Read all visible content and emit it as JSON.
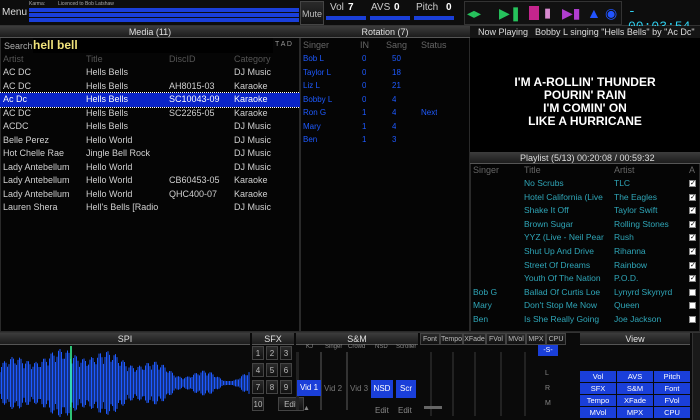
{
  "top": {
    "menu_label": "Menu",
    "karma_label": "Karma:",
    "license_text": "Licenced to Bob Latshaw",
    "mute_label": "Mute",
    "vol_label": "Vol",
    "vol_value": "7",
    "avs_label": "AVS",
    "avs_value": "0",
    "pitch_label": "Pitch",
    "pitch_value": "0",
    "time": "- 00:03:54"
  },
  "media": {
    "header": "Media (11)",
    "search_label": "Search",
    "search_value": "hell bell",
    "tad_label": "T A D",
    "columns": [
      "Artist",
      "Title",
      "DiscID",
      "Category"
    ],
    "rows": [
      [
        "AC DC",
        "Hells Bells",
        "",
        "DJ Music"
      ],
      [
        "AC DC",
        "Hells Bells",
        "AH8015-03",
        "Karaoke"
      ],
      [
        "Ac Dc",
        "Hells Bells",
        "SC10043-09",
        "Karaoke"
      ],
      [
        "AC DC",
        "Hells Bells",
        "SC2265-05",
        "Karaoke"
      ],
      [
        "ACDC",
        "Hells Bells",
        "",
        "DJ Music"
      ],
      [
        "Belle Perez",
        "Hello World",
        "",
        "DJ Music"
      ],
      [
        "Hot Chelle Rae",
        "Jingle Bell Rock",
        "",
        "DJ Music"
      ],
      [
        "Lady Antebellum",
        "Hello World",
        "",
        "DJ Music"
      ],
      [
        "Lady Antebellum",
        "Hello World",
        "CB60453-05",
        "Karaoke"
      ],
      [
        "Lady Antebellum",
        "Hello World",
        "QHC400-07",
        "Karaoke"
      ],
      [
        "Lauren Shera",
        "Hell's Bells [Radio",
        "",
        "DJ Music"
      ]
    ],
    "selected_index": 2
  },
  "rotation": {
    "header": "Rotation (7)",
    "columns": [
      "Singer",
      "IN",
      "Sang",
      "Status"
    ],
    "rows": [
      [
        "Bob L",
        "0",
        "50",
        ""
      ],
      [
        "Taylor L",
        "0",
        "18",
        ""
      ],
      [
        "Liz L",
        "0",
        "21",
        ""
      ],
      [
        "Bobby L",
        "0",
        "4",
        ""
      ],
      [
        "Ron G",
        "1",
        "4",
        "Next"
      ],
      [
        "Mary",
        "1",
        "4",
        ""
      ],
      [
        "Ben",
        "1",
        "3",
        ""
      ]
    ]
  },
  "now_playing": {
    "label": "Now Playing",
    "text": "Bobby L singing \"Hells Bells\" by \"Ac Dc\"",
    "lyrics": [
      "I'M A-ROLLIN' THUNDER",
      "POURIN' RAIN",
      "I'M COMIN' ON",
      "LIKE A HURRICANE"
    ]
  },
  "playlist": {
    "header": "Playlist (5/13)",
    "times": "00:20:08 / 00:59:32",
    "columns": [
      "Singer",
      "Title",
      "Artist",
      "A"
    ],
    "rows": [
      [
        "",
        "No Scrubs",
        "TLC",
        true
      ],
      [
        "",
        "Hotel California (Live",
        "The Eagles",
        true
      ],
      [
        "",
        "Shake It Off",
        "Taylor Swift",
        true
      ],
      [
        "",
        "Brown Sugar",
        "Rolling Stones",
        true
      ],
      [
        "",
        "YYZ (Live - Neil Pear",
        "Rush",
        true
      ],
      [
        "",
        "Shut Up And Drive",
        "Rihanna",
        true
      ],
      [
        "",
        "Street Of Dreams",
        "Rainbow",
        true
      ],
      [
        "",
        "Youth Of The Nation",
        "P.O.D.",
        true
      ],
      [
        "Bob G",
        "Ballad Of Curtis Loe",
        "Lynyrd Skynyrd",
        false
      ],
      [
        "Mary",
        "Don't Stop Me Now",
        "Queen",
        false
      ],
      [
        "Ben",
        "Is She Really Going",
        "Joe Jackson",
        false
      ]
    ]
  },
  "bottom": {
    "spi_label": "SPI",
    "sfx_label": "SFX",
    "sfx_buttons": [
      "1",
      "2",
      "3",
      "4",
      "5",
      "6",
      "7",
      "8",
      "9",
      "10",
      "Edit"
    ],
    "sm_label": "S&M",
    "sm_headers": [
      "KJ",
      "Singer",
      "Crowd",
      "NSD",
      "Scroller"
    ],
    "vid_buttons": [
      "Vid 1",
      "Vid 2",
      "Vid 3"
    ],
    "nsd_label": "NSD",
    "scr_label": "Scr",
    "edit_label": "Edit",
    "tabs": [
      "Font",
      "Tempo",
      "XFade",
      "FVol",
      "MVol",
      "MPX",
      "CPU"
    ],
    "mpx_value": "-S-",
    "lr": [
      "L",
      "R",
      "M"
    ],
    "view_label": "View",
    "view_buttons": [
      "Vol",
      "AVS",
      "Pitch",
      "SFX",
      "S&M",
      "Font",
      "Tempo",
      "XFade",
      "FVol",
      "MVol",
      "MPX",
      "CPU"
    ]
  },
  "colors": {
    "accent_blue": "#1a3fd9",
    "selected_row": "#0a24c8",
    "teal_text": "#2fa6b8",
    "waveform": "#1e5aff",
    "lyric_text": "#ffffff"
  }
}
